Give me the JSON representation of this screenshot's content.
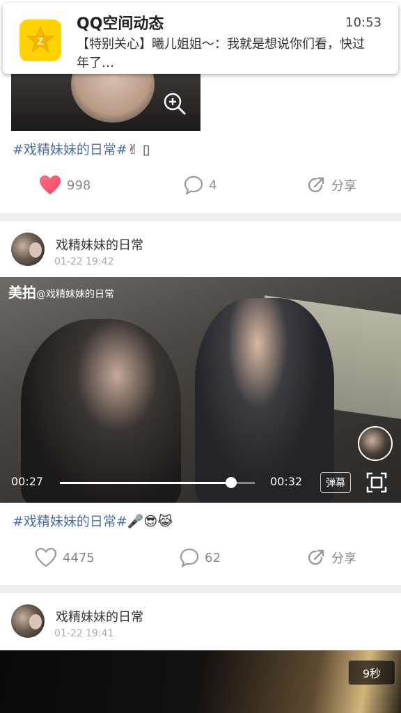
{
  "notification": {
    "app_title": "QQ空间动态",
    "time": "10:53",
    "body": "【特别关心】曦儿姐姐～：我就是想说你们看，快过年了…"
  },
  "posts": [
    {
      "hashtag": "#戏精妹妹的日常#",
      "emoji": "✌ ▯",
      "likes": "998",
      "comments": "4",
      "share_label": "分享",
      "liked": true
    },
    {
      "user": "戏精妹妹的日常",
      "time": "01-22 19:42",
      "watermark_brand": "美拍",
      "watermark_handle": "@戏精妹妹的日常",
      "current_time": "00:27",
      "duration": "00:32",
      "progress": 0.88,
      "danmu_label": "弹幕",
      "hashtag": "#戏精妹妹的日常#",
      "emoji": "🎤😎😹",
      "likes": "4475",
      "comments": "62",
      "share_label": "分享",
      "liked": false
    },
    {
      "user": "戏精妹妹的日常",
      "time": "01-22 19:41",
      "duration_badge": "9秒"
    }
  ],
  "colors": {
    "hashtag": "#4a6fa8",
    "like_active": "#f2455a",
    "separator": "#eeeeee",
    "app_icon": "#ffd200"
  }
}
